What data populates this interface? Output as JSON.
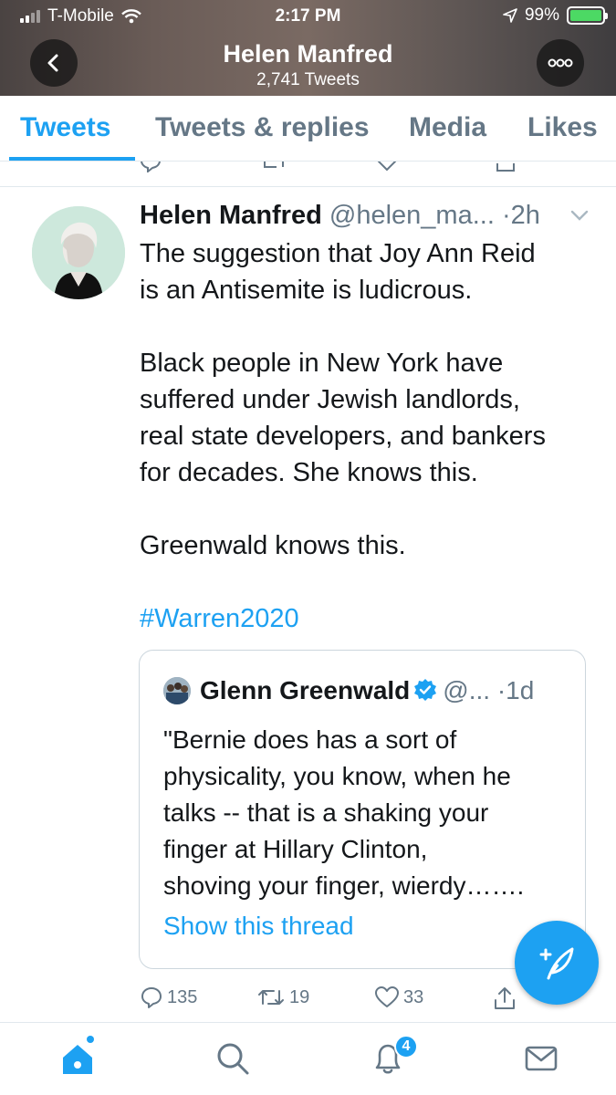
{
  "status_bar": {
    "carrier": "T-Mobile",
    "time": "2:17 PM",
    "battery": "99%"
  },
  "header": {
    "title": "Helen Manfred",
    "subtitle": "2,741 Tweets"
  },
  "tabs": [
    {
      "label": "Tweets",
      "active": true
    },
    {
      "label": "Tweets & replies",
      "active": false
    },
    {
      "label": "Media",
      "active": false
    },
    {
      "label": "Likes",
      "active": false
    }
  ],
  "tweet": {
    "name": "Helen Manfred",
    "handle": "@helen_ma...",
    "time": "·2h",
    "lines": [
      "The suggestion that Joy Ann Reid",
      "is an Antisemite is ludicrous.",
      "",
      "Black people in New York have",
      "suffered under Jewish landlords,",
      "real state developers, and bankers",
      "for decades. She knows this.",
      "",
      "Greenwald knows this.",
      ""
    ],
    "hashtag": "#Warren2020",
    "quote": {
      "name": "Glenn Greenwald",
      "handle": "@...",
      "time": "·1d",
      "lines": [
        "\"Bernie does has a sort of",
        "physicality, you know, when he",
        "talks -- that is a shaking your",
        "finger at Hillary Clinton,",
        "shoving your finger, wierdy……."
      ],
      "link": "Show this thread"
    },
    "actions": {
      "replies": "135",
      "retweets": "19",
      "likes": "33"
    }
  },
  "bottom_nav": {
    "notifications_badge": "4"
  },
  "colors": {
    "accent": "#1da1f2",
    "text": "#14171a",
    "secondary": "#657786"
  }
}
